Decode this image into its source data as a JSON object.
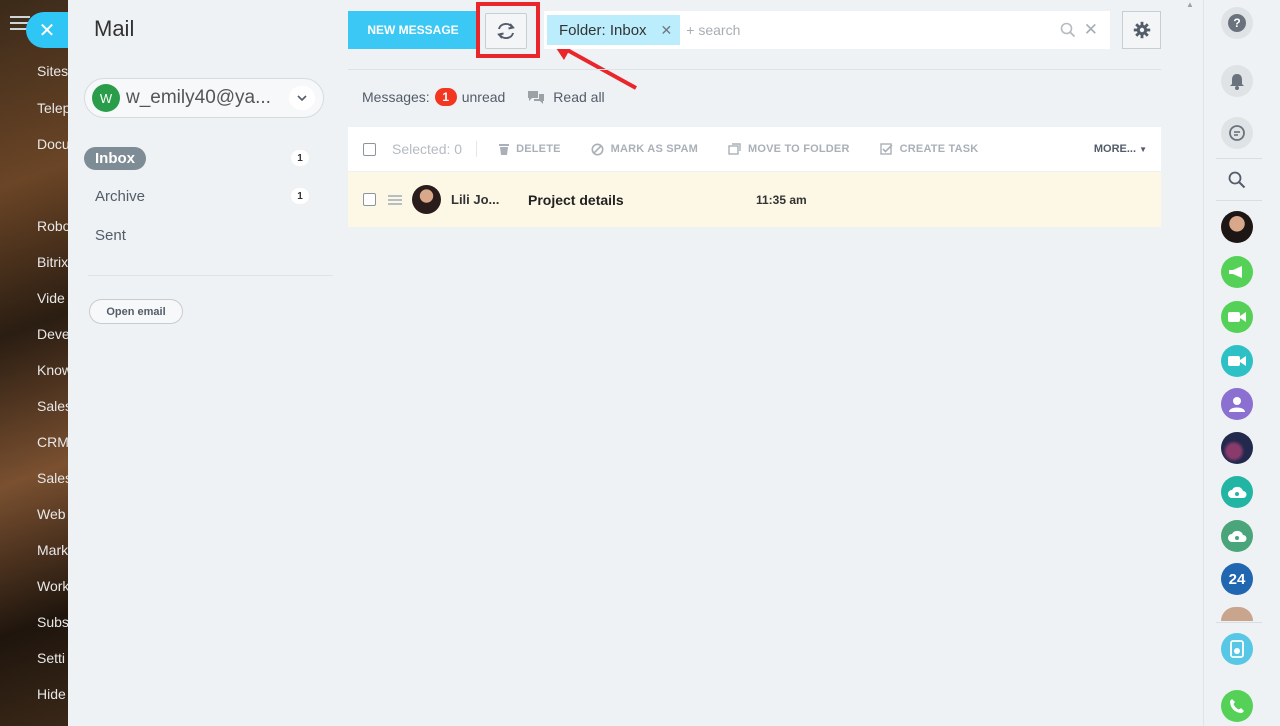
{
  "background_menu": {
    "items": [
      "Sites",
      "Telep",
      "Docu",
      "Robo",
      "Bitrix",
      "Vide",
      "Deve",
      "Know",
      "Sales",
      "CRM",
      "Sales",
      "Web",
      "Mark",
      "Work",
      "Subs",
      "Setti",
      "Hide"
    ]
  },
  "panel": {
    "title": "Mail",
    "account": {
      "avatar_letter": "W",
      "email": "w_emily40@ya..."
    },
    "folders": [
      {
        "label": "Inbox",
        "count": "1"
      },
      {
        "label": "Archive",
        "count": "1"
      },
      {
        "label": "Sent",
        "count": ""
      }
    ],
    "open_email_label": "Open email"
  },
  "toolbar": {
    "new_message_label": "NEW MESSAGE",
    "filter_tag": "Folder: Inbox",
    "search_placeholder": "+ search"
  },
  "counter": {
    "prefix": "Messages:",
    "unread_count": "1",
    "unread_label": "unread",
    "read_all_label": "Read all"
  },
  "grid": {
    "selected_label": "Selected: 0",
    "actions": [
      "DELETE",
      "MARK AS SPAM",
      "MOVE TO FOLDER",
      "CREATE TASK"
    ],
    "more_label": "MORE...",
    "rows": [
      {
        "sender": "Lili Jo...",
        "subject": "Project details",
        "time": "11:35 am"
      }
    ]
  },
  "rail": {
    "counter_24": "24"
  },
  "colors": {
    "accent": "#3bc8f5",
    "highlight": "#e8262b",
    "unread_badge": "#f2361f",
    "row_highlight": "#fdf8e6"
  }
}
